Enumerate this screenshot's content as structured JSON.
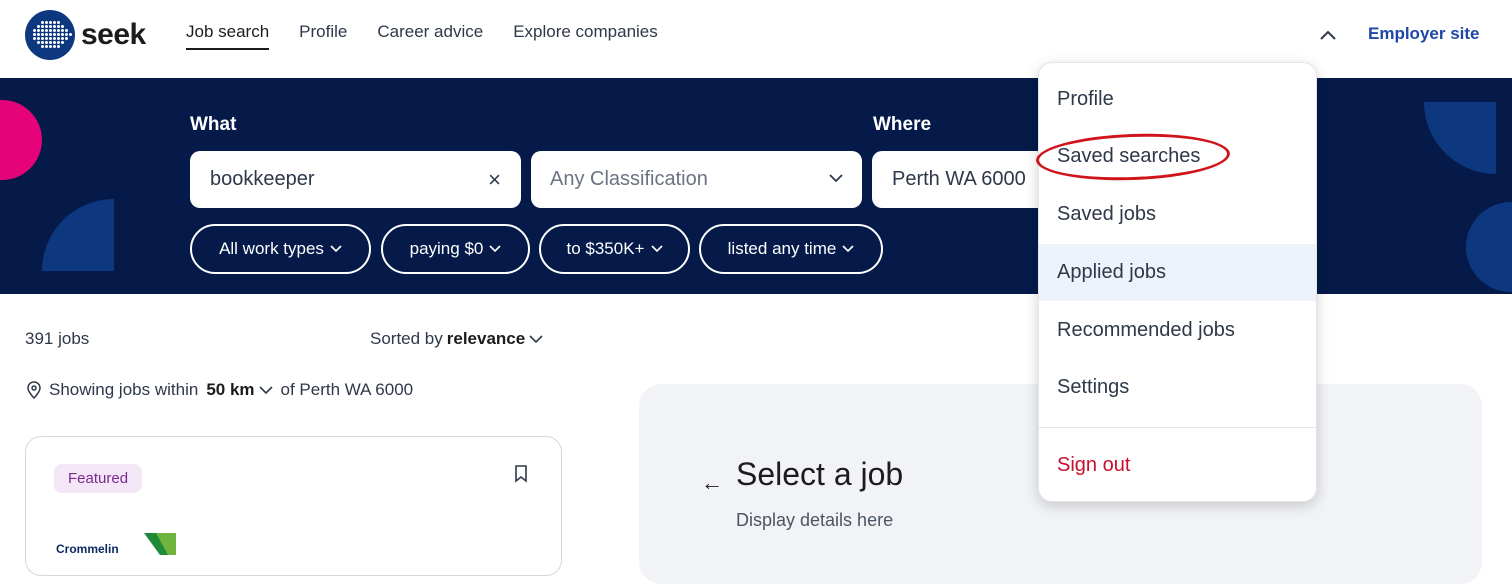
{
  "nav": {
    "logo_text": "seek",
    "links": [
      "Job search",
      "Profile",
      "Career advice",
      "Explore companies"
    ],
    "employer_site": "Employer site",
    "chevron_icon": "chevron-up-icon"
  },
  "search": {
    "what_label": "What",
    "where_label": "Where",
    "what_value": "bookkeeper",
    "classification_placeholder": "Any Classification",
    "where_value": "Perth WA 6000",
    "clear_icon": "×",
    "filters": [
      "All work types",
      "paying $0",
      "to $350K+",
      "listed any time"
    ]
  },
  "results": {
    "count": "391 jobs",
    "sorted_prefix": "Sorted by",
    "sorted_value": "relevance",
    "showing_prefix": "Showing jobs within",
    "radius": "50 km",
    "showing_suffix": "of Perth WA 6000",
    "card": {
      "badge": "Featured",
      "company_logo_text": "Crommelin"
    }
  },
  "detail": {
    "title": "Select a job",
    "subtitle": "Display details here"
  },
  "menu": {
    "items": [
      "Profile",
      "Saved searches",
      "Saved jobs",
      "Applied jobs",
      "Recommended jobs",
      "Settings"
    ],
    "sign_out": "Sign out",
    "highlighted": "Applied jobs",
    "annotated": "Saved searches"
  },
  "colors": {
    "brand_navy": "#051a49",
    "brand_blue": "#0d3880",
    "brand_pink": "#e60278",
    "link_blue": "#1e47a8",
    "sign_out_red": "#c8102e",
    "annotation_red": "#d0141c"
  }
}
